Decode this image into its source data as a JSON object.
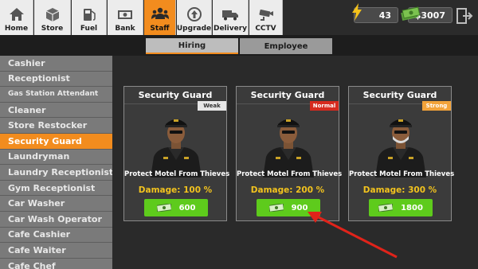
{
  "nav": {
    "tabs": [
      {
        "label": "Home",
        "icon": "home-icon"
      },
      {
        "label": "Store",
        "icon": "box-icon"
      },
      {
        "label": "Fuel",
        "icon": "fuel-pump-icon"
      },
      {
        "label": "Bank",
        "icon": "money-icon"
      },
      {
        "label": "Staff",
        "icon": "people-icon",
        "active": true
      },
      {
        "label": "Upgrade",
        "icon": "upgrade-icon"
      },
      {
        "label": "Delivery",
        "icon": "truck-icon"
      },
      {
        "label": "CCTV",
        "icon": "camera-icon"
      }
    ],
    "energy": "43",
    "money": "$3007"
  },
  "subtabs": {
    "hiring": "Hiring",
    "employee": "Employee"
  },
  "sidebar": {
    "items": [
      {
        "label": "Cashier"
      },
      {
        "label": "Receptionist"
      },
      {
        "label": "Gas Station Attendant"
      },
      {
        "label": "Cleaner"
      },
      {
        "label": "Store Restocker"
      },
      {
        "label": "Security Guard",
        "active": true
      },
      {
        "label": "Laundryman"
      },
      {
        "label": "Laundry Receptionist"
      },
      {
        "label": "Gym Receptionist"
      },
      {
        "label": "Car Washer"
      },
      {
        "label": "Car Wash Operator"
      },
      {
        "label": "Cafe Cashier"
      },
      {
        "label": "Cafe Waiter"
      },
      {
        "label": "Cafe Chef"
      }
    ]
  },
  "cards": [
    {
      "title": "Security Guard",
      "tag": "Weak",
      "desc": "Protect Motel From Thieves",
      "damage": "Damage: 100 %",
      "price": "600"
    },
    {
      "title": "Security Guard",
      "tag": "Normal",
      "desc": "Protect Motel From Thieves",
      "damage": "Damage: 200 %",
      "price": "900"
    },
    {
      "title": "Security Guard",
      "tag": "Strong",
      "desc": "Protect Motel From Thieves",
      "damage": "Damage: 300 %",
      "price": "1800"
    }
  ],
  "colors": {
    "accent": "#f28c1e",
    "buy": "#5ecb1c",
    "damage": "#f2c31e",
    "arrow": "#e0231a"
  }
}
